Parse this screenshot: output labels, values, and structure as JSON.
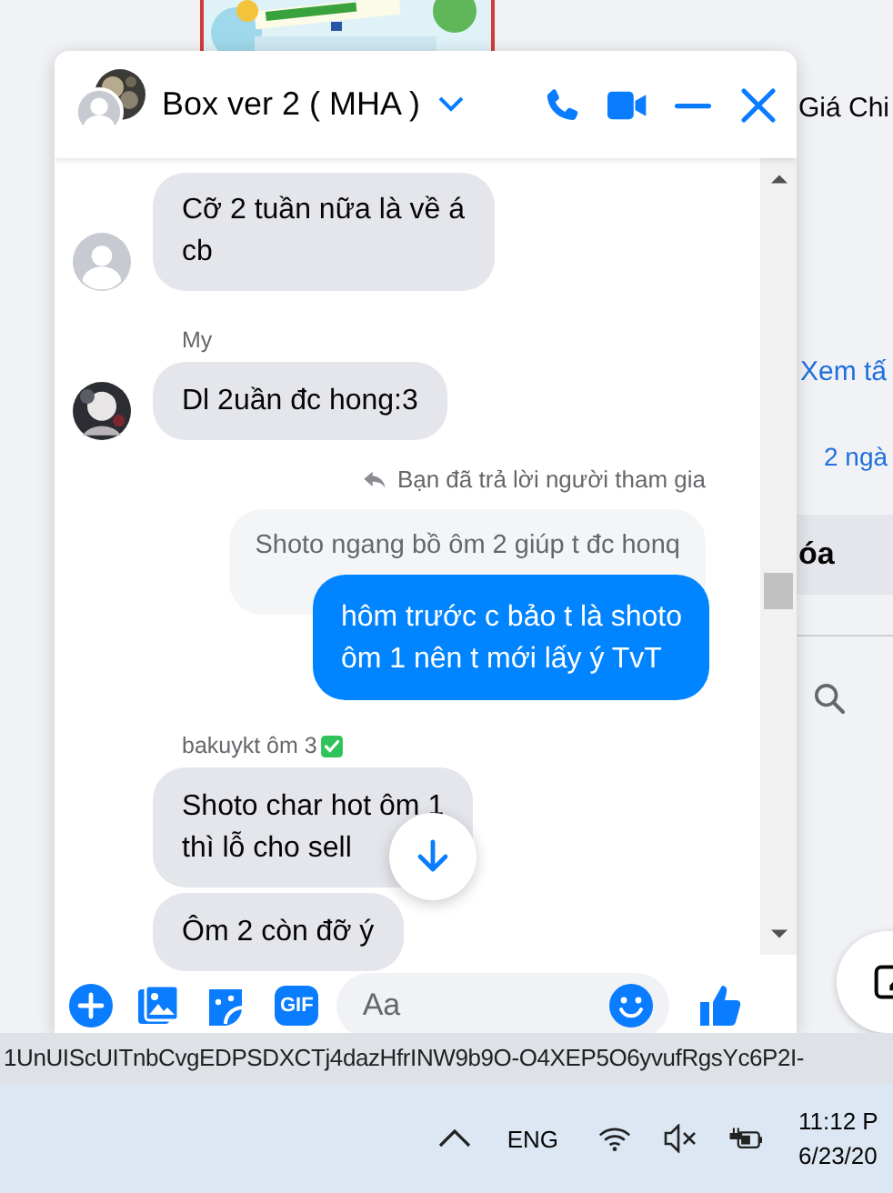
{
  "background_page": {
    "heading": "Giá Chi",
    "link": "Xem tấ",
    "time": "2 ngà",
    "tab": "óa"
  },
  "chat": {
    "title": "Box ver 2 ( MHA )",
    "messages": [
      {
        "kind": "incoming",
        "text": "Cỡ 2 tuần nữa là về á\ncb",
        "avatar": {
          "kind": "default"
        }
      },
      {
        "kind": "sender",
        "text": "My"
      },
      {
        "kind": "incoming",
        "text": "Dl 2uần đc hong:3"
      },
      {
        "kind": "reply_note",
        "text": "Bạn đã trả lời người tham gia"
      },
      {
        "kind": "quote",
        "text": "Shoto ngang bồ ôm 2 giúp t đc honq"
      },
      {
        "kind": "outgoing",
        "text": "hôm trước c bảo t là shoto\nôm 1 nên t mới lấy ý TvT"
      },
      {
        "kind": "sender",
        "text": "bakuykt ôm 3",
        "verified": true
      },
      {
        "kind": "incoming",
        "text": "Shoto char hot ôm 1\nthì lỗ cho sell"
      },
      {
        "kind": "incoming",
        "text": "Ôm 2 còn đỡ ý"
      }
    ],
    "composer": {
      "gif_label": "GIF",
      "placeholder": "Aa"
    }
  },
  "url_status": "1UnUIScUITnbCvgEDPSDXCTj4dazHfrINW9b9O-O4XEP5O6yvufRgsYc6P2I-",
  "taskbar": {
    "language": "ENG",
    "time": "11:12 P",
    "date": "6/23/20"
  }
}
